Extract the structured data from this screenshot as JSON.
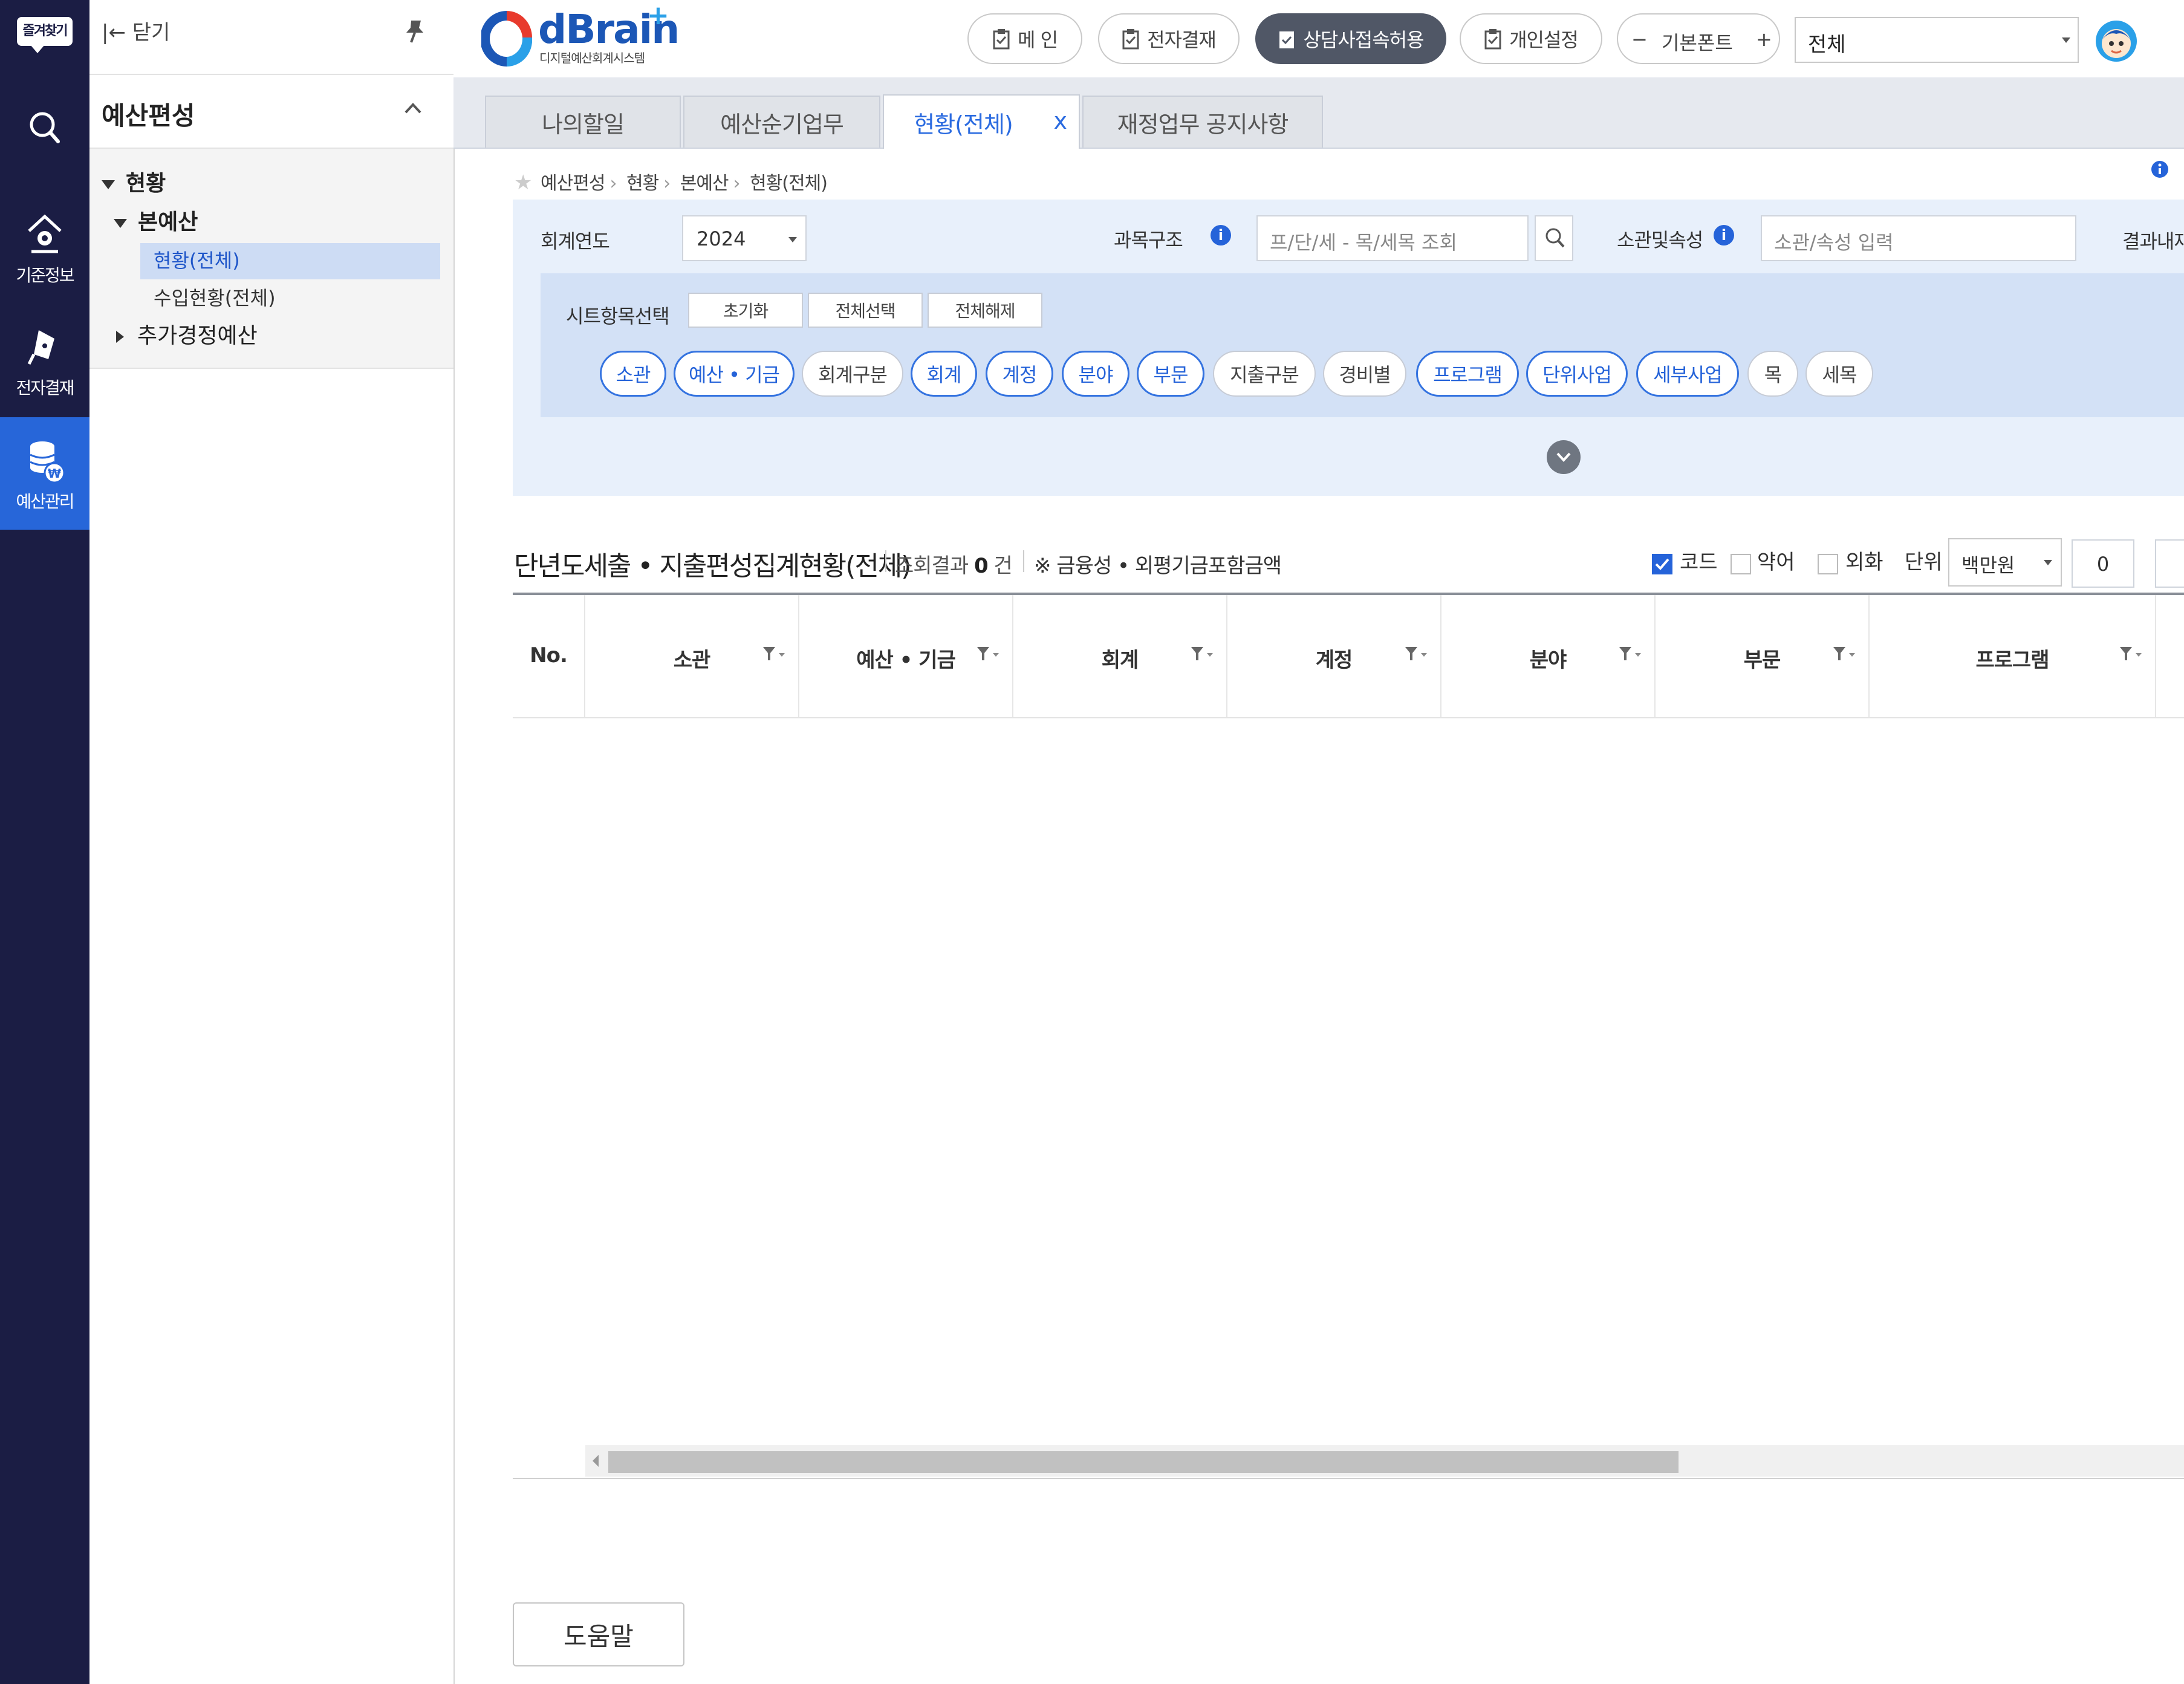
{
  "iconbar": {
    "favorites_label": "즐겨찾기",
    "items": [
      {
        "label": "",
        "icon": "search-icon"
      },
      {
        "label": "기준정보",
        "icon": "home-gear-icon"
      },
      {
        "label": "전자결재",
        "icon": "pen-icon"
      },
      {
        "label": "예산관리",
        "icon": "database-won-icon"
      }
    ],
    "active_color": "#2766d9",
    "bg_color": "#1b1d44"
  },
  "sidebar": {
    "close_label": "|← 닫기",
    "section_title": "예산편성",
    "tree": [
      {
        "label": "현황"
      },
      {
        "label": "본예산"
      },
      {
        "label": "현황(전체)"
      },
      {
        "label": "수입현황(전체)"
      },
      {
        "label": "추가경정예산"
      }
    ]
  },
  "header": {
    "logo_text": "dBrain",
    "logo_plus": "+",
    "logo_sub": "디지털예산회계시스템",
    "buttons": {
      "approve": "메 인",
      "e_approval": "전자결재",
      "consult": "상담사접속허용",
      "personal": "개인설정"
    },
    "font_minus": "−",
    "font_label": "기본폰트",
    "font_plus": "+",
    "scope_value": "전체"
  },
  "tabs": [
    {
      "label": "나의할일"
    },
    {
      "label": "예산순기업무"
    },
    {
      "label": "현황(전체)",
      "close": "x"
    },
    {
      "label": "재정업무 공지사항"
    }
  ],
  "breadcrumb": [
    "예산편성",
    "현황",
    "본예산",
    "현황(전체)"
  ],
  "search": {
    "year_label": "회계연도",
    "year_value": "2024",
    "structure_label": "과목구조",
    "structure_placeholder": "프/단/세 - 목/세목 조회",
    "dept_label": "소관및속성",
    "dept_placeholder": "소관/속성 입력",
    "result_label": "결과내재",
    "sheet_label": "시트항목선택",
    "btn_reset": "초기화",
    "btn_select_all": "전체선택",
    "btn_clear_all": "전체해제",
    "chips": [
      {
        "label": "소관",
        "on": true
      },
      {
        "label": "예산 • 기금",
        "on": true
      },
      {
        "label": "회계구분",
        "on": false
      },
      {
        "label": "회계",
        "on": true
      },
      {
        "label": "계정",
        "on": true
      },
      {
        "label": "분야",
        "on": true
      },
      {
        "label": "부문",
        "on": true
      },
      {
        "label": "지출구분",
        "on": false
      },
      {
        "label": "경비별",
        "on": false
      },
      {
        "label": "프로그램",
        "on": true
      },
      {
        "label": "단위사업",
        "on": true
      },
      {
        "label": "세부사업",
        "on": true
      },
      {
        "label": "목",
        "on": false
      },
      {
        "label": "세목",
        "on": false
      }
    ]
  },
  "grid": {
    "title": "단년도세출 • 지출편성집계현황(전체)",
    "result_prefix": "조회결과",
    "result_count": "0",
    "result_suffix": "건",
    "note": "※ 금융성 • 외평기금포함금액",
    "opt_code": "코드",
    "opt_code_checked": true,
    "opt_abbr": "약어",
    "opt_foreign": "외화",
    "unit_label": "단위",
    "unit_value": "백만원",
    "decimal_value": "0",
    "columns": [
      "No.",
      "소관",
      "예산 • 기금",
      "회계",
      "계정",
      "분야",
      "부문",
      "프로그램"
    ],
    "rows": []
  },
  "help_label": "도움말"
}
